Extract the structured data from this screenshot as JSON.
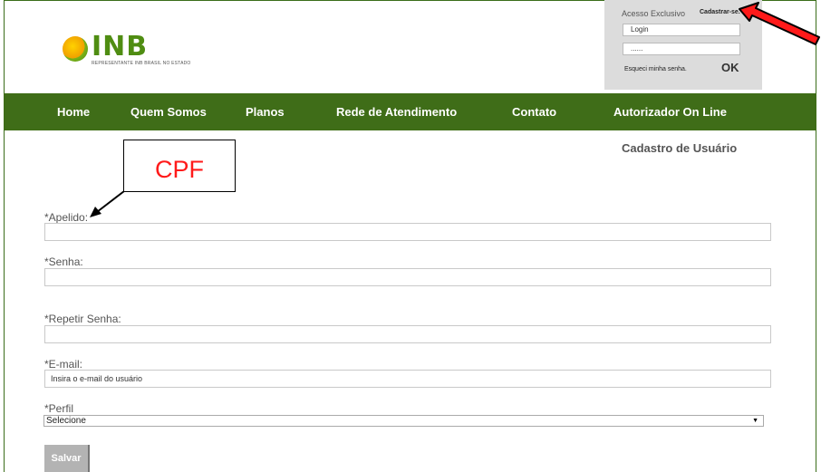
{
  "brand": {
    "logo_text": "INB",
    "tagline": "REPRESENTANTE INB BRASIL NO ESTADO"
  },
  "login": {
    "title": "Acesso Exclusivo",
    "signup_link": "Cadastrar-se.",
    "login_value": "Login",
    "password_value": "......",
    "forgot_link": "Esqueci minha senha.",
    "ok_button": "OK"
  },
  "nav": {
    "items": [
      {
        "label": "Home"
      },
      {
        "label": "Quem Somos"
      },
      {
        "label": "Planos"
      },
      {
        "label": "Rede de Atendimento"
      },
      {
        "label": "Contato"
      },
      {
        "label": "Autorizador On Line"
      }
    ]
  },
  "form": {
    "title": "Cadastro de Usuário",
    "fields": {
      "apelido": {
        "label": "*Apelido:",
        "value": ""
      },
      "senha": {
        "label": "*Senha:",
        "value": ""
      },
      "repetir": {
        "label": "*Repetir Senha:",
        "value": ""
      },
      "email": {
        "label": "*E-mail:",
        "value": "Insira o e-mail do usuário"
      },
      "perfil": {
        "label": "*Perfil",
        "selected": "Selecione"
      }
    },
    "save_button": "Salvar"
  },
  "annotation": {
    "text": "CPF"
  },
  "colors": {
    "nav_bg": "#3f6d18",
    "annotation_red": "#ff1a1a",
    "brand_green": "#4f8d12"
  }
}
